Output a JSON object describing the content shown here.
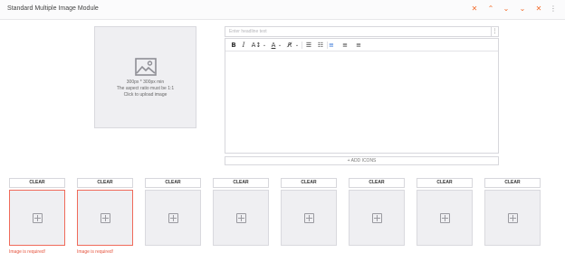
{
  "header": {
    "title": "Standard Multiple Image Module",
    "buttons": [
      {
        "name": "close-icon",
        "glyph": "✕"
      },
      {
        "name": "chevron-up-icon",
        "glyph": "⌃"
      },
      {
        "name": "chevron-down-icon",
        "glyph": "⌄"
      },
      {
        "name": "collapse-icon",
        "glyph": "⌄"
      },
      {
        "name": "remove-icon",
        "glyph": "✕"
      },
      {
        "name": "more-menu-icon",
        "glyph": "⋮"
      }
    ]
  },
  "main_image": {
    "size_hint": "300px * 300px min",
    "ratio_hint": "The aspect ratio must be 1:1",
    "click_hint": "Click to upload image"
  },
  "headline": {
    "placeholder": "Enter headline text",
    "menu_glyph": "⋮"
  },
  "toolbar": {
    "bold": "B",
    "italic": "I",
    "font_size": "A↕",
    "font_color": "A",
    "clear_format": "R̸",
    "bullet_list": "☰",
    "numbered_list": "☷",
    "align_left": "≡",
    "align_center": "≡",
    "align_right": "≡",
    "dropdown": "⌄"
  },
  "add_icons": {
    "label": "+  ADD ICONS"
  },
  "slots": {
    "clear_label": "CLEAR",
    "error_text": "Image is required!",
    "items": [
      {
        "error": true
      },
      {
        "error": true
      },
      {
        "error": false
      },
      {
        "error": false
      },
      {
        "error": false
      },
      {
        "error": false
      },
      {
        "error": false
      },
      {
        "error": false
      }
    ]
  },
  "colors": {
    "accent": "#f26b2b",
    "error": "#e5533d",
    "active_tool": "#2b6fd6",
    "placeholder_bg": "#efeff2"
  }
}
